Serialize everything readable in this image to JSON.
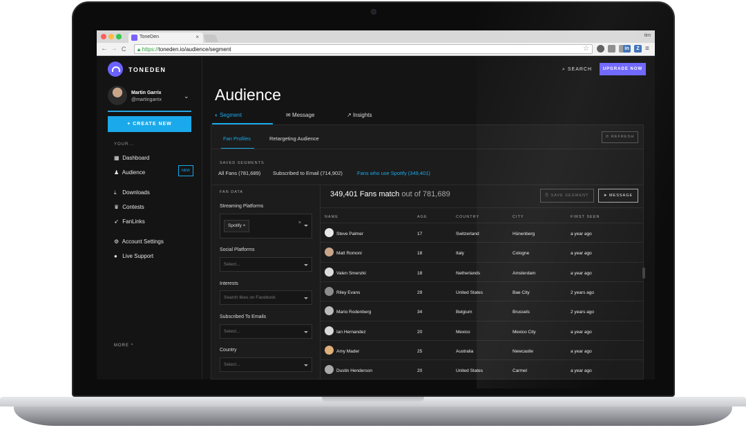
{
  "browser": {
    "tab_title": "ToneDen",
    "tab_close": "×",
    "user": "tim",
    "url_scheme": "https://",
    "url_rest": "toneden.io/audience/segment",
    "nav_back": "←",
    "nav_forward": "→",
    "nav_reload": "C",
    "star": "☆",
    "extensions": [
      {
        "label": "",
        "color": "#5a5a5a"
      },
      {
        "label": "",
        "color": "#8a8a8a"
      },
      {
        "label": "",
        "color": "#9a9a9a"
      },
      {
        "label": "in",
        "color": "#3b6fb6"
      },
      {
        "label": "Z",
        "color": "#3b6fb6"
      }
    ],
    "menu": "≡"
  },
  "sidebar": {
    "logo_text": "TONEDEN",
    "user_name": "Martin Garrix",
    "user_handle": "@martingarrix",
    "chevron": "⌄",
    "create_button": "+ CREATE NEW",
    "section_label": "YOUR...",
    "items": [
      {
        "icon": "▦",
        "label": "Dashboard"
      },
      {
        "icon": "♟",
        "label": "Audience"
      },
      {
        "icon": "⤓",
        "label": "Downloads"
      },
      {
        "icon": "♛",
        "label": "Contests"
      },
      {
        "icon": "➶",
        "label": "FanLinks"
      },
      {
        "icon": "⚙",
        "label": "Account Settings"
      },
      {
        "icon": "●",
        "label": "Live Support"
      }
    ],
    "new_badge": "NEW",
    "more": "MORE ^"
  },
  "header": {
    "search": "⌕ SEARCH",
    "upgrade": "UPGRADE NOW"
  },
  "page": {
    "title": "Audience",
    "tabs": [
      {
        "icon": "◐",
        "label": "Segment"
      },
      {
        "icon": "✉",
        "label": "Message"
      },
      {
        "icon": "↗",
        "label": "Insights"
      }
    ]
  },
  "panel": {
    "subtabs": [
      "Fan Profiles",
      "Retargeting Audience"
    ],
    "refresh": "⟳ REFRESH",
    "saved_label": "SAVED SEGMENTS",
    "segments": [
      "All Fans (781,689)",
      "Subscribed to Email (714,902)",
      "Fans who use Spotify (349,401)"
    ]
  },
  "filters": {
    "title": "FAN DATA",
    "streaming_label": "Streaming Platforms",
    "streaming_chip": "Spotify  ×",
    "clear": "×",
    "social_label": "Social Platforms",
    "social_placeholder": "Select...",
    "interests_label": "Interests",
    "interests_placeholder": "Search likes on Facebook",
    "emails_label": "Subscribed To Emails",
    "emails_placeholder": "Select...",
    "country_label": "Country",
    "country_placeholder": "Select..."
  },
  "results": {
    "match_count": "349,401 Fans match",
    "match_of": " out of 781,689",
    "save_segment": "⎘ SAVE SEGMENT",
    "message": "➤ MESSAGE",
    "columns": [
      "NAME",
      "AGE",
      "COUNTRY",
      "CITY",
      "FIRST SEEN"
    ],
    "rows": [
      {
        "name": "Steve Palmer",
        "age": "17",
        "country": "Switzerland",
        "city": "Hünenberg",
        "first_seen": "a year ago"
      },
      {
        "name": "Matt Romoni",
        "age": "18",
        "country": "Italy",
        "city": "Cologne",
        "first_seen": "a year ago"
      },
      {
        "name": "Valen Smenzki",
        "age": "18",
        "country": "Netherlands",
        "city": "Amsterdam",
        "first_seen": "a year ago"
      },
      {
        "name": "Riley Evans",
        "age": "29",
        "country": "United States",
        "city": "Bae City",
        "first_seen": "2 years ago"
      },
      {
        "name": "Mario Rodenberg",
        "age": "34",
        "country": "Belgium",
        "city": "Brussels",
        "first_seen": "2 years ago"
      },
      {
        "name": "Ian Hernandez",
        "age": "20",
        "country": "Mexico",
        "city": "Mexico City",
        "first_seen": "a year ago"
      },
      {
        "name": "Amy Mader",
        "age": "25",
        "country": "Australia",
        "city": "Newcastle",
        "first_seen": "a year ago"
      },
      {
        "name": "Dustin Henderson",
        "age": "20",
        "country": "United States",
        "city": "Carmel",
        "first_seen": "a year ago"
      }
    ]
  },
  "colors": {
    "accent_blue": "#1aa9ea",
    "upgrade_purple": "#6c63ff",
    "background": "#141414"
  }
}
